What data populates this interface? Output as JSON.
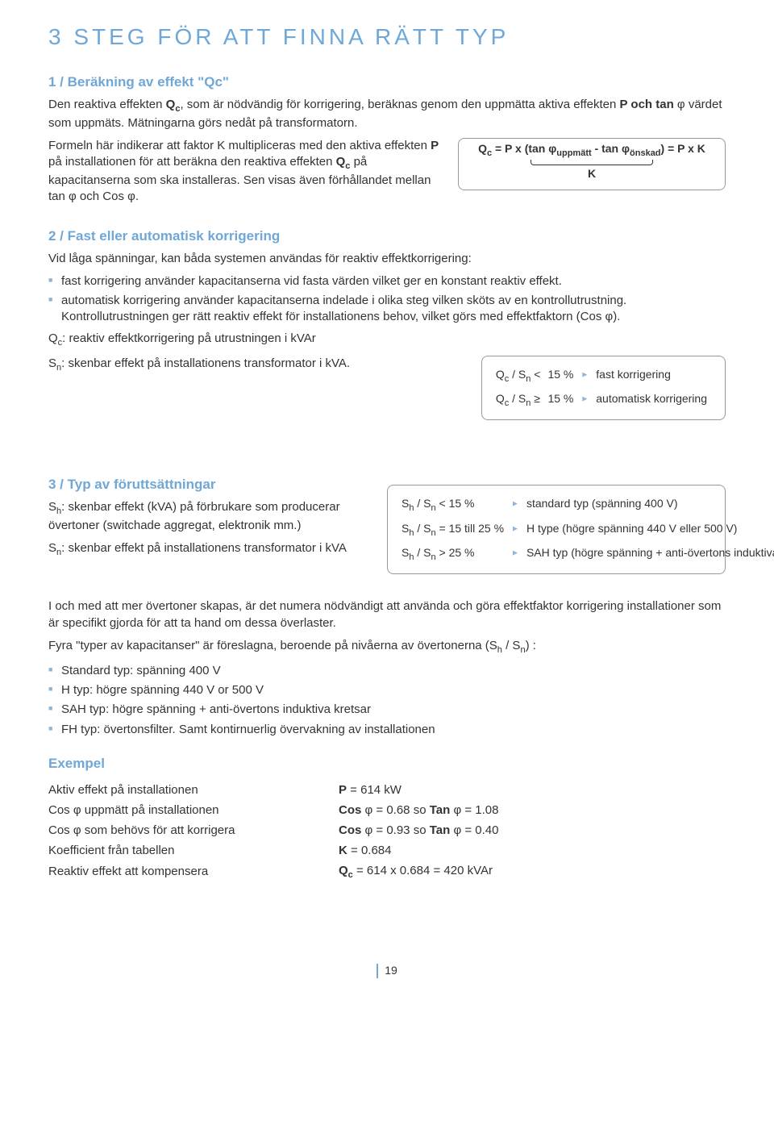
{
  "title": "3 STEG FÖR  ATT FINNA RÄTT TYP",
  "s1": {
    "head": "1 / Beräkning av effekt \"Qc\"",
    "p1a": "Den reaktiva effekten ",
    "p1c": ", som är nödvändig för korrigering, beräknas genom den uppmätta aktiva effekten ",
    "p1e": " värdet som uppmäts. Mätningarna görs nedåt på transformatorn.",
    "p2a": "Formeln här indikerar att faktor K multipliceras med den aktiva effekten ",
    "p2b": " på installationen för att beräkna den reaktiva effekten ",
    "p2c": " på kapacitanserna som ska installeras. Sen visas även förhållandet mellan tan φ och Cos φ.",
    "formula": "Qc = P x (tan φuppmätt - tan φönskad) = P x K",
    "K": "K"
  },
  "s2": {
    "head": "2 / Fast eller automatisk korrigering",
    "intro": "Vid låga spänningar, kan båda systemen användas för reaktiv effektkorrigering:",
    "b1": "fast korrigering använder kapacitanserna vid fasta värden vilket ger en konstant reaktiv effekt.",
    "b2": "automatisk korrigering använder kapacitanserna indelade i olika steg vilken sköts av en kontrollutrustning. Kontrollutrustningen ger rätt reaktiv effekt för installationens behov, vilket görs med effektfaktorn (Cos φ).",
    "qcline": "Qc: reaktiv effektkorrigering på utrustningen i kVAr",
    "snline": "Sn: skenbar effekt på installationens transformator i kVA.",
    "box": {
      "r1a": "Qc / Sn <",
      "r1b": "15 %",
      "r1c": "fast korrigering",
      "r2a": "Qc / Sn ≥",
      "r2b": "15 %",
      "r2c": "automatisk korrigering"
    }
  },
  "s3": {
    "head": "3 / Typ av föruttsättningar",
    "sha": "Sh: skenbar effekt (kVA) på förbrukare som producerar övertoner (switchade aggregat, elektronik mm.)",
    "sna": "Sn: skenbar effekt på installationens transformator i kVA",
    "box": {
      "c1a": "Sh / Sn < 15 %",
      "c1b": "standard typ (spänning 400 V)",
      "c2a": "Sh / Sn = 15 till 25 %",
      "c2b": "H type (högre spänning 440 V eller 500 V)",
      "c3a": "Sh / Sn > 25 %",
      "c3b": "SAH typ (högre spänning + anti-övertons induktiva kretsar)"
    }
  },
  "bottom": {
    "p1": "I och med att mer övertoner skapas, är det numera nödvändigt att använda och göra effektfaktor korrigering installationer som är specifikt gjorda för att ta hand om dessa överlaster.",
    "p2": "Fyra \"typer av kapacitanser\" är föreslagna, beroende på nivåerna av övertonerna (Sh / Sn) :",
    "b1": "Standard typ: spänning 400 V",
    "b2": "H typ: högre spänning 440 V or 500 V",
    "b3": "SAH typ: högre spänning + anti-övertons induktiva kretsar",
    "b4": "FH typ: övertonsfilter.  Samt kontirnuerlig övervakning av installationen"
  },
  "ex": {
    "head": "Exempel",
    "r1a": "Aktiv effekt på installationen",
    "r1b": "P = 614 kW",
    "r2a": "Cos φ uppmätt på installationen",
    "r2b": "Cos φ = 0.68 so Tan φ = 1.08",
    "r3a": "Cos φ som behövs för att korrigera",
    "r3b": "Cos φ = 0.93 so Tan φ = 0.40",
    "r4a": "Koefficient från tabellen",
    "r4b": "K = 0.684",
    "r5a": "Reaktiv effekt att kompensera",
    "r5b": "Qc = 614 x 0.684 = 420 kVAr"
  },
  "page_number": "19"
}
